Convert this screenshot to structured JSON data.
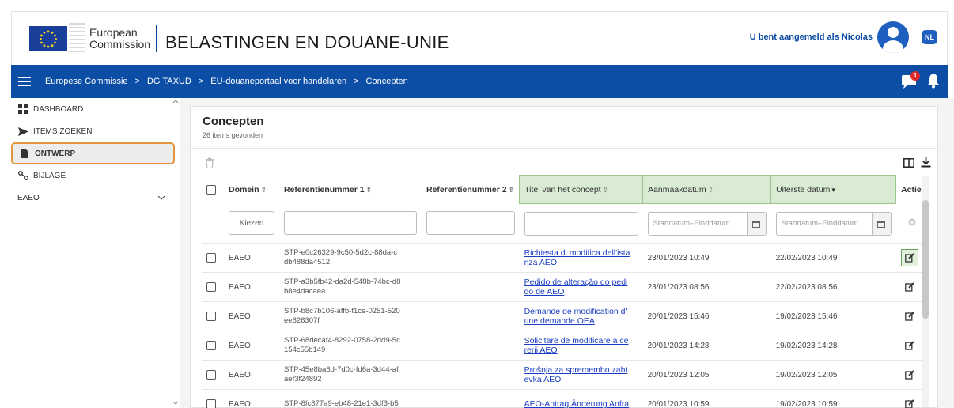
{
  "header": {
    "org_line1": "European",
    "org_line2": "Commission",
    "site_title": "BELASTINGEN EN DOUANE-UNIE",
    "user_text": "U bent aangemeld als Nicolas",
    "language": "NL"
  },
  "nav": {
    "breadcrumbs": [
      "Europese Commissie",
      "DG TAXUD",
      "EU-douaneportaal voor handelaren",
      "Concepten"
    ],
    "separator": ">",
    "notification_count": "1"
  },
  "sidebar": {
    "items": [
      {
        "label": "DASHBOARD",
        "icon": "dashboard-icon"
      },
      {
        "label": "ITEMS ZOEKEN",
        "icon": "send-icon"
      },
      {
        "label": "ONTWERP",
        "icon": "document-icon"
      },
      {
        "label": "BIJLAGE",
        "icon": "paperclip-icon"
      },
      {
        "label": "EAEO",
        "icon": "chevron-down-icon"
      }
    ]
  },
  "main": {
    "title": "Concepten",
    "subtitle": "26 items gevonden",
    "columns": [
      "Domein",
      "Referentienummer 1",
      "Referentienummer 2",
      "Titel van het concept",
      "Aanmaakdatum",
      "Uiterste datum",
      "Actie"
    ],
    "filters": {
      "domain_select": "Kiezen",
      "date_start": "Startdatum",
      "date_end": "Einddatum",
      "date_sep": "–"
    },
    "rows": [
      {
        "domain": "EAEO",
        "ref1a": "STP-e0c26329-9c50-5d2c-88da-c",
        "ref1b": "db488da4512",
        "title_a": "Richiesta di modifica dell'ista",
        "title_b": "nza AEO",
        "created": "23/01/2023 10:49",
        "deadline": "22/02/2023 10:49"
      },
      {
        "domain": "EAEO",
        "ref1a": "STP-a3b5fb42-da2d-548b-74bc-d8",
        "ref1b": "b8e4dacaea",
        "title_a": "Pedido de alteração do pedi",
        "title_b": "do de AEO",
        "created": "23/01/2023 08:56",
        "deadline": "22/02/2023 08:56"
      },
      {
        "domain": "EAEO",
        "ref1a": "STP-b8c7b106-affb-f1ce-0251-520",
        "ref1b": "ee626307f",
        "title_a": "Demande de modification d'",
        "title_b": "une demande OEA",
        "created": "20/01/2023 15:46",
        "deadline": "19/02/2023 15:46"
      },
      {
        "domain": "EAEO",
        "ref1a": "STP-68decaf4-8292-0758-2dd9-5c",
        "ref1b": "154c55b149",
        "title_a": "Solicitare de modificare a ce",
        "title_b": "rerii AEO",
        "created": "20/01/2023 14:28",
        "deadline": "19/02/2023 14:28"
      },
      {
        "domain": "EAEO",
        "ref1a": "STP-45e8ba6d-7d0c-fd6a-3d44-af",
        "ref1b": "aef3f24892",
        "title_a": "Prošnja za spremembo zaht",
        "title_b": "evka AEO",
        "created": "20/01/2023 12:05",
        "deadline": "19/02/2023 12:05"
      },
      {
        "domain": "EAEO",
        "ref1a": "STP-8fc877a9-eb48-21e1-3df3-b5",
        "ref1b": "",
        "title_a": "AEO-Antrag Änderung Anfra",
        "title_b": "",
        "created": "20/01/2023 10:59",
        "deadline": "19/02/2023 10:59"
      }
    ]
  }
}
